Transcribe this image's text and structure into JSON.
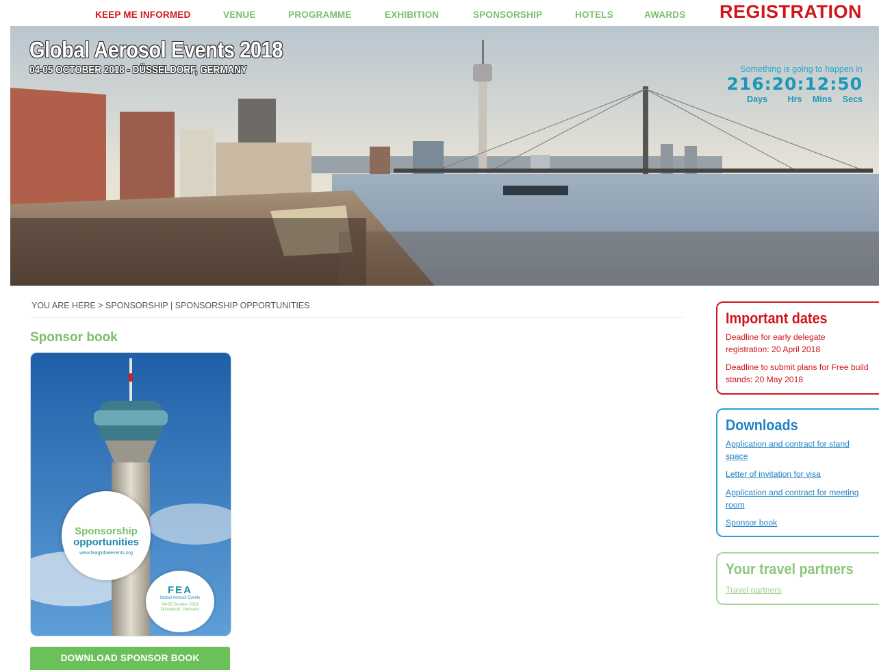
{
  "nav": {
    "items": [
      {
        "label": "KEEP ME INFORMED",
        "style": "red"
      },
      {
        "label": "VENUE",
        "style": "green"
      },
      {
        "label": "PROGRAMME",
        "style": "green"
      },
      {
        "label": "EXHIBITION",
        "style": "green"
      },
      {
        "label": "SPONSORSHIP",
        "style": "green"
      },
      {
        "label": "HOTELS",
        "style": "green"
      },
      {
        "label": "AWARDS",
        "style": "green"
      }
    ],
    "registration": "REGISTRATION"
  },
  "hero": {
    "title": "Global Aerosol Events 2018",
    "subtitle": "04-05 OCTOBER 2018 - DÜSSELDORF, GERMANY",
    "countdown": {
      "caption": "Something is going to happen in",
      "value": "216:20:12:50",
      "units": [
        "Days",
        "Hrs",
        "Mins",
        "Secs"
      ]
    }
  },
  "main": {
    "breadcrumb": "YOU ARE HERE > SPONSORSHIP | SPONSORSHIP OPPORTUNITIES",
    "section_title": "Sponsor book",
    "book": {
      "line1": "Sponsorship",
      "line2": "opportunities",
      "url": "www.feaglobalevents.org",
      "logo": "FEA",
      "logo_sub": "Global Aerosol Events",
      "dates": "04-05 October 2018",
      "place": "Düsseldorf, Germany"
    },
    "download_button": "DOWNLOAD SPONSOR BOOK"
  },
  "sidebar": {
    "important": {
      "title": "Important dates",
      "items": [
        "Deadline for early delegate registration: 20 April 2018",
        "Deadline to submit plans for Free build stands: 20 May 2018"
      ]
    },
    "downloads": {
      "title": "Downloads",
      "links": [
        "Application and contract for stand space",
        "Letter of invitation for visa",
        "Application and contract for meeting room",
        "Sponsor book"
      ]
    },
    "travel": {
      "title": "Your travel partners",
      "link": "Travel partners"
    }
  },
  "colors": {
    "nav_green": "#7bbf6a",
    "red": "#d0161b",
    "blue": "#2a9fd6",
    "button_green": "#6cc05a",
    "countdown_blue": "#1b98b9"
  }
}
